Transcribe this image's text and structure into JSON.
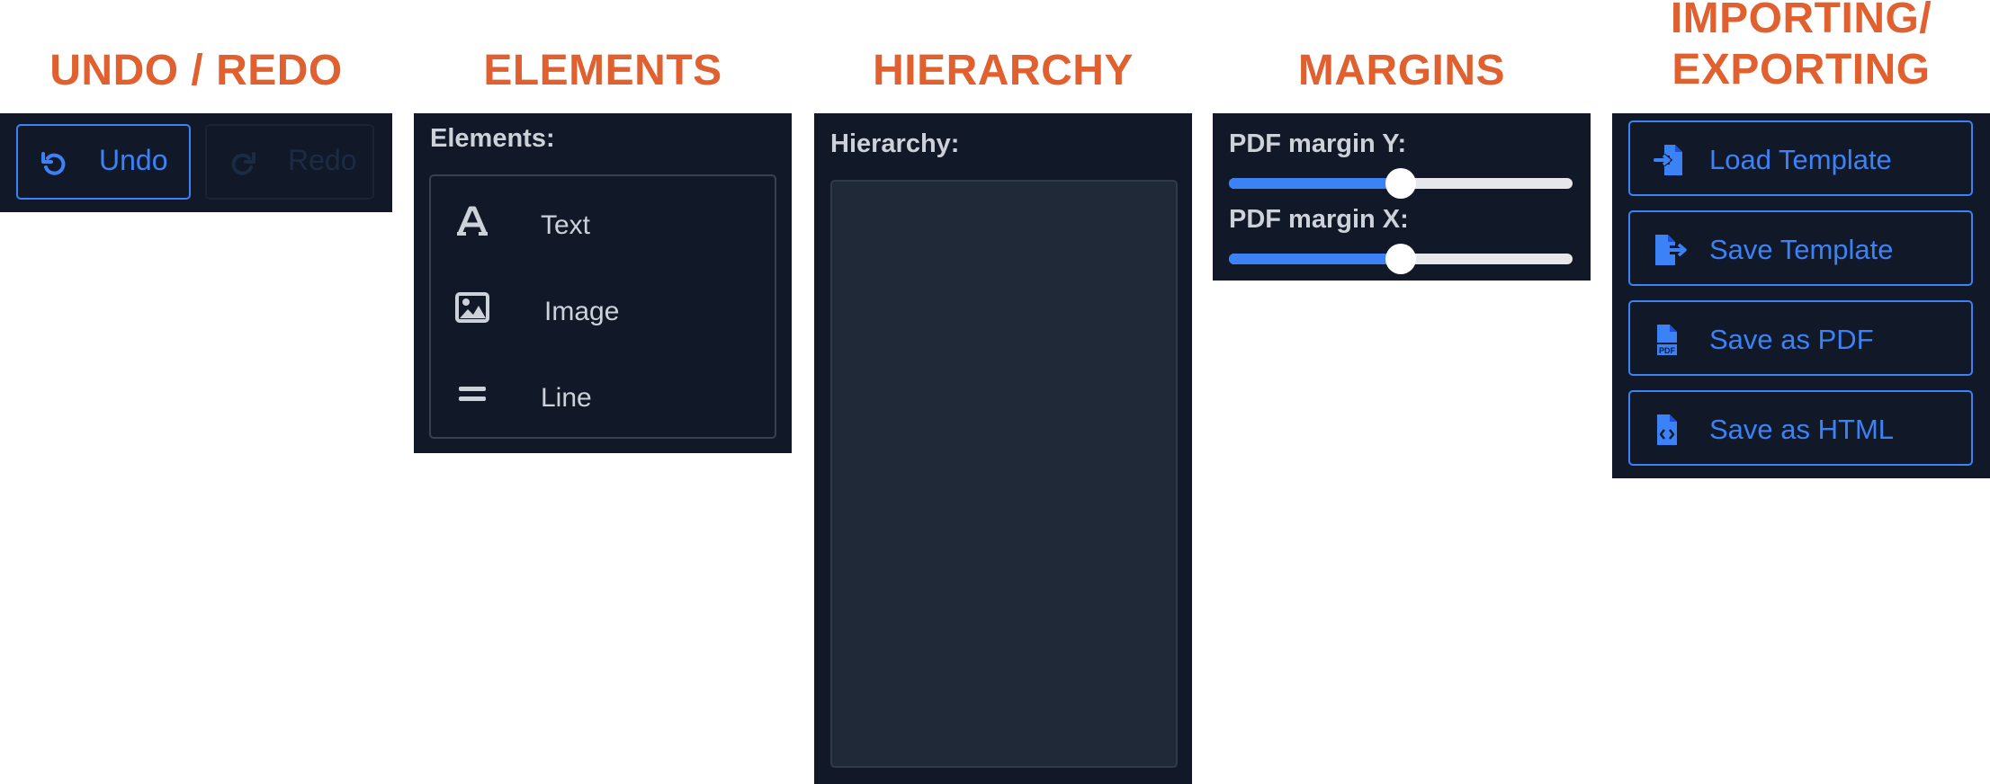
{
  "headings": {
    "undo_redo": "UNDO / REDO",
    "elements": "ELEMENTS",
    "hierarchy": "HIERARCHY",
    "margins": "MARGINS",
    "import_export_line1": "IMPORTING/",
    "import_export_line2": "EXPORTING"
  },
  "undo_redo": {
    "undo_label": "Undo",
    "redo_label": "Redo",
    "undo_icon": "rotate-ccw-icon",
    "redo_icon": "rotate-cw-icon"
  },
  "elements": {
    "title": "Elements:",
    "items": [
      {
        "label": "Text",
        "icon": "font-icon"
      },
      {
        "label": "Image",
        "icon": "image-icon"
      },
      {
        "label": "Line",
        "icon": "equals-icon"
      }
    ]
  },
  "hierarchy": {
    "title": "Hierarchy:"
  },
  "margins": {
    "y_label": "PDF margin Y:",
    "x_label": "PDF margin X:",
    "y_value_fraction": 0.5,
    "x_value_fraction": 0.5
  },
  "import_export": {
    "buttons": [
      {
        "label": "Load Template",
        "icon": "file-import-icon"
      },
      {
        "label": "Save Template",
        "icon": "file-export-icon"
      },
      {
        "label": "Save as PDF",
        "icon": "file-pdf-icon"
      },
      {
        "label": "Save as HTML",
        "icon": "file-code-icon"
      }
    ]
  },
  "colors": {
    "heading": "#e0612f",
    "panel_bg": "#111827",
    "accent": "#3b82f6",
    "disabled": "#1c2b44",
    "text": "#cdd2da"
  }
}
